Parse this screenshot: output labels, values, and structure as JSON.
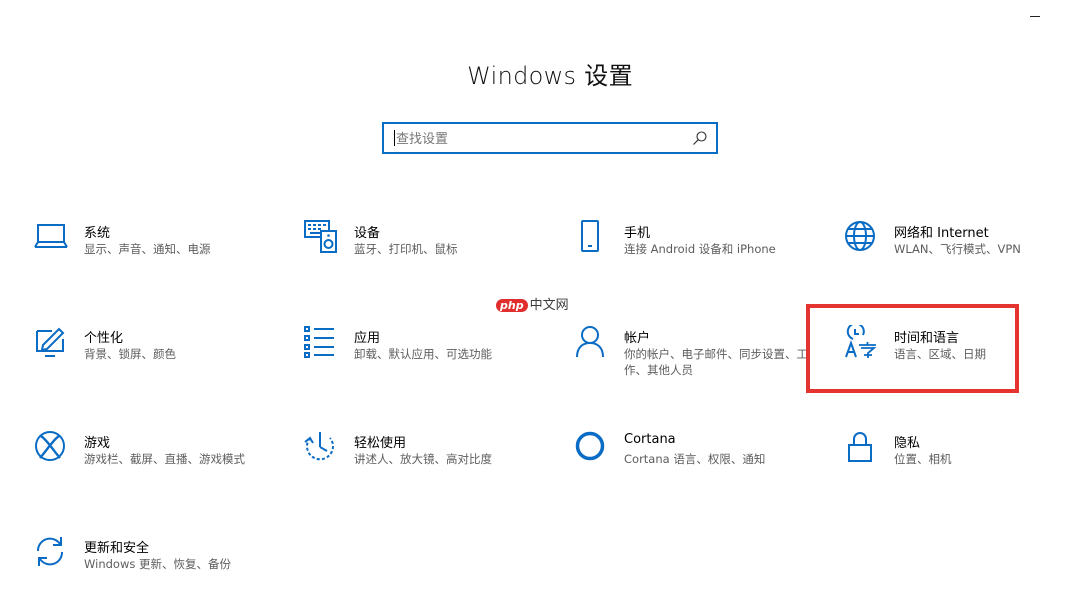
{
  "window": {
    "title": "Windows 设置"
  },
  "search": {
    "placeholder": "查找设置"
  },
  "accent_color": "#0a6cc4",
  "highlight_color": "#e3342f",
  "watermark": {
    "logo": "php",
    "text": "中文网"
  },
  "tiles": [
    {
      "icon": "laptop-icon",
      "name": "系统",
      "desc": "显示、声音、通知、电源"
    },
    {
      "icon": "keyboard-devices-icon",
      "name": "设备",
      "desc": "蓝牙、打印机、鼠标"
    },
    {
      "icon": "phone-icon",
      "name": "手机",
      "desc": "连接 Android 设备和 iPhone"
    },
    {
      "icon": "globe-icon",
      "name": "网络和 Internet",
      "desc": "WLAN、飞行模式、VPN"
    },
    {
      "icon": "personalization-icon",
      "name": "个性化",
      "desc": "背景、锁屏、颜色"
    },
    {
      "icon": "apps-list-icon",
      "name": "应用",
      "desc": "卸载、默认应用、可选功能"
    },
    {
      "icon": "person-icon",
      "name": "帐户",
      "desc": "你的帐户、电子邮件、同步设置、工作、其他人员"
    },
    {
      "icon": "time-language-icon",
      "name": "时间和语言",
      "desc": "语言、区域、日期"
    },
    {
      "icon": "xbox-icon",
      "name": "游戏",
      "desc": "游戏栏、截屏、直播、游戏模式"
    },
    {
      "icon": "ease-of-access-icon",
      "name": "轻松使用",
      "desc": "讲述人、放大镜、高对比度"
    },
    {
      "icon": "cortana-icon",
      "name": "Cortana",
      "desc": "Cortana 语言、权限、通知"
    },
    {
      "icon": "lock-icon",
      "name": "隐私",
      "desc": "位置、相机"
    },
    {
      "icon": "update-sync-icon",
      "name": "更新和安全",
      "desc": "Windows 更新、恢复、备份"
    }
  ]
}
